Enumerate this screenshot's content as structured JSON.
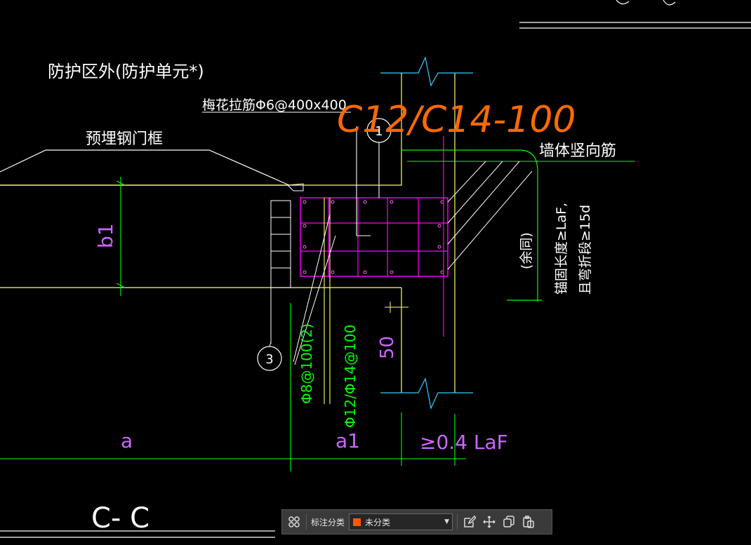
{
  "drawing": {
    "texts": {
      "protect_zone": "防护区外(防护单元*)",
      "tie_bar": "梅花拉筋Φ6@400x400",
      "handwritten_note": "C12/C14-100",
      "embed_frame": "预埋钢门框",
      "wall_vertical_bar": "墙体竖向筋",
      "callout_1": "1",
      "callout_3": "3",
      "dim_b1": "b1",
      "anchor_line1": "锚固长度≥LaF,",
      "anchor_line2": "且弯折段≥15d",
      "anchor_same": "(余同)",
      "stirrup": "Φ8@100(2)",
      "long_bar": "Φ12/Φ14@100",
      "dim_50": "50",
      "dim_a": "a",
      "dim_a1": "a1",
      "dim_laf": "≥0.4 LaF",
      "section_label": "C- C"
    },
    "colors": {
      "background": "#000000",
      "white": "#ffffff",
      "yellow": "#ffff66",
      "green": "#00ff00",
      "magenta": "#ff00ff",
      "purple": "#cc66ff",
      "cyan": "#33ccff",
      "orange": "#ff6a00"
    }
  },
  "toolbar": {
    "grid_icon": "grid-icon",
    "label": "标注分类",
    "dropdown_value": "未分类",
    "dropdown_swatch": "#ff5a00",
    "edit_icon": "edit-icon",
    "move_icon": "move-icon",
    "copy_icon": "copy-icon",
    "paste_icon": "paste-icon"
  }
}
